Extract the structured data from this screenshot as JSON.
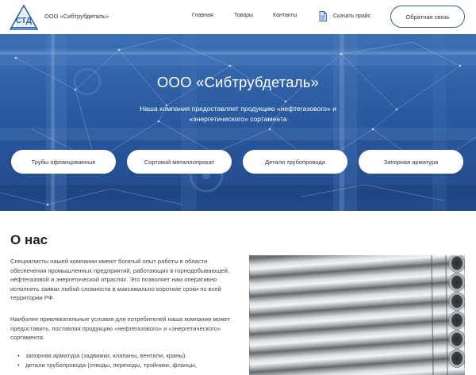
{
  "header": {
    "logo_text": "СТД",
    "company_name": "ООО «Сибтрубдеталь»",
    "nav": [
      "Главная",
      "Товары",
      "Контакты"
    ],
    "download_price": "Скачать прайс",
    "feedback_button": "Обратная связь"
  },
  "hero": {
    "title": "ООО «Сибтрубдеталь»",
    "subtitle": "Наша компания предоставляет продукцию «нефтегазового» и «энергетического» сортамента",
    "categories": [
      "Трубы офланцованные",
      "Сортовой металлопрокат",
      "Детали трубопровода",
      "Запорная арматура"
    ]
  },
  "about": {
    "title": "О нас",
    "paragraph1": "Специалисты нашей компании имеют богатый опыт работы в области обеспечения промышленных предприятий, работающих в горнодобывающей, нефтегазовой и энергетической отраслях. Это позволяет нам оперативно исполнять заявки любой сложности в максимально короткие сроки по всей территории РФ.",
    "paragraph2": "Наиболее привлекательные условия для потребителей наша компания может предоставить, поставляя продукцию «нефтегазового» и «энергетического» сортамента:",
    "list": [
      "запорная арматура (задвижки, клапаны, вентили, краны).",
      "детали трубопровода (отводы, переходы, тройники, фланцы,"
    ]
  },
  "colors": {
    "accent": "#2a5ea8",
    "hero_blue": "#2a5aa0"
  }
}
